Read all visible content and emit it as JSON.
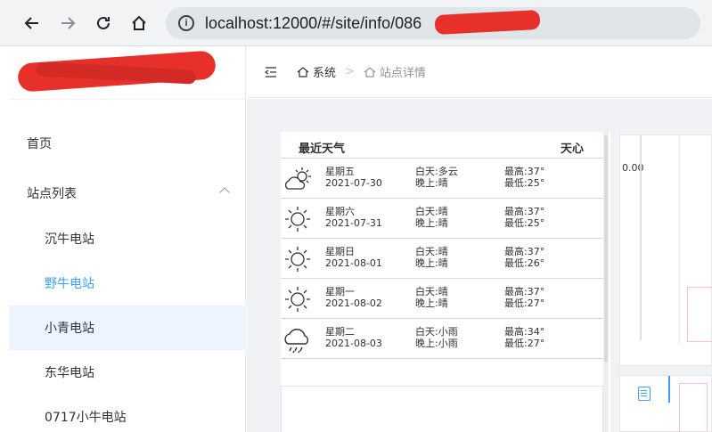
{
  "browser": {
    "url": "localhost:12000/#/site/info/086"
  },
  "sidebar": {
    "items": [
      {
        "label": "首页"
      },
      {
        "label": "站点列表"
      },
      {
        "label": "沉牛电站"
      },
      {
        "label": "野牛电站"
      },
      {
        "label": "小青电站"
      },
      {
        "label": "东华电站"
      },
      {
        "label": "0717小牛电站"
      }
    ]
  },
  "breadcrumb": {
    "items": [
      "系统",
      "站点详情"
    ],
    "separator": ">"
  },
  "weather": {
    "title": "最近天气",
    "source": "天心",
    "days": [
      {
        "weekday": "星期五",
        "date": "2021-07-30",
        "day": "白天:多云",
        "night": "晚上:晴",
        "high": "最高:37°",
        "low": "最低:25°",
        "icon": "partly-cloudy-icon"
      },
      {
        "weekday": "星期六",
        "date": "2021-07-31",
        "day": "白天:晴",
        "night": "晚上:晴",
        "high": "最高:37°",
        "low": "最低:25°",
        "icon": "sunny-icon"
      },
      {
        "weekday": "星期日",
        "date": "2021-08-01",
        "day": "白天:晴",
        "night": "晚上:晴",
        "high": "最高:37°",
        "low": "最低:26°",
        "icon": "sunny-icon"
      },
      {
        "weekday": "星期一",
        "date": "2021-08-02",
        "day": "白天:晴",
        "night": "晚上:晴",
        "high": "最高:37°",
        "low": "最低:27°",
        "icon": "sunny-icon"
      },
      {
        "weekday": "星期二",
        "date": "2021-08-03",
        "day": "白天:小雨",
        "night": "晚上:小雨",
        "high": "最高:34°",
        "low": "最低:27°",
        "icon": "rain-icon"
      }
    ]
  },
  "right_panel": {
    "value": "0.00"
  },
  "colors": {
    "accent": "#409eff",
    "active_bg": "#ecf5ff",
    "main_bg": "#f0f2f5"
  }
}
